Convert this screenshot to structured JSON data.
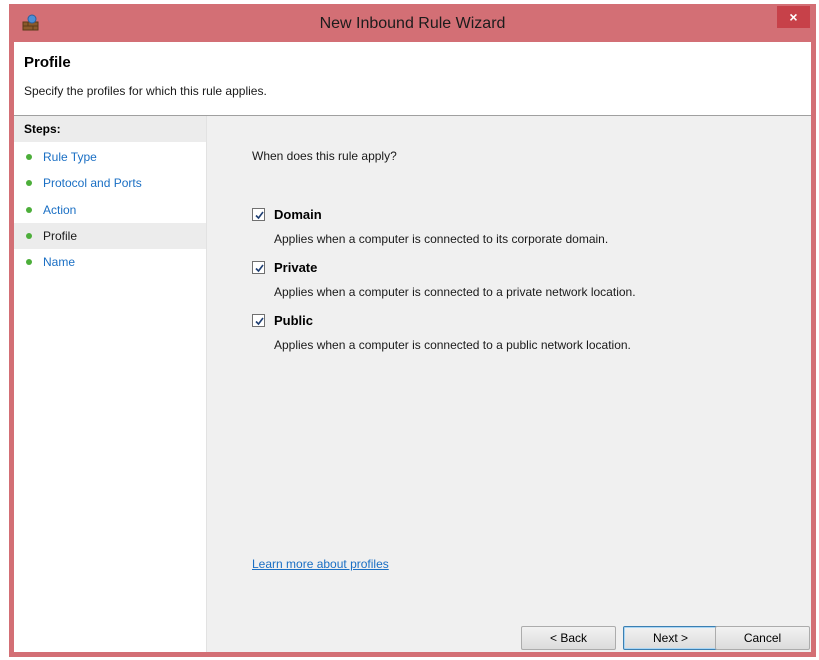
{
  "window": {
    "title": "New Inbound Rule Wizard",
    "close_label": "×",
    "accent_color": "#d36f75"
  },
  "header": {
    "title": "Profile",
    "subtitle": "Specify the profiles for which this rule applies."
  },
  "steps": {
    "heading": "Steps:",
    "items": [
      {
        "label": "Rule Type"
      },
      {
        "label": "Protocol and Ports"
      },
      {
        "label": "Action"
      },
      {
        "label": "Profile"
      },
      {
        "label": "Name"
      }
    ]
  },
  "main": {
    "question": "When does this rule apply?",
    "options": [
      {
        "label": "Domain",
        "description": "Applies when a computer is connected to its corporate domain.",
        "checked": true
      },
      {
        "label": "Private",
        "description": "Applies when a computer is connected to a private network location.",
        "checked": true
      },
      {
        "label": "Public",
        "description": "Applies when a computer is connected to a public network location.",
        "checked": true
      }
    ],
    "learn_more": "Learn more about profiles"
  },
  "buttons": {
    "back": "< Back",
    "next": "Next >",
    "cancel": "Cancel"
  }
}
